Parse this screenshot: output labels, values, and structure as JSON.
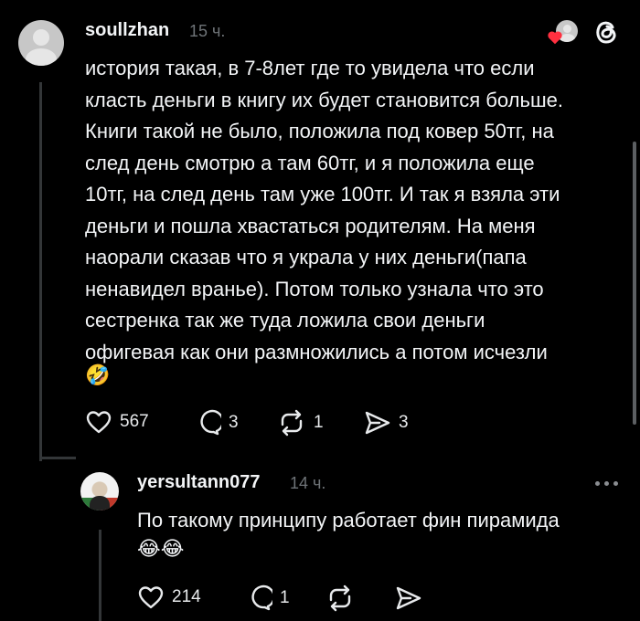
{
  "post": {
    "username": "soullzhan",
    "time": "15 ч.",
    "text": "история такая, в 7-8лет где то увидела что если\nкласть деньги в книгу их будет становится больше.\nКниги такой не было, положила под ковер 50тг, на\nслед день смотрю а там 60тг, и я положила еще\n10тг, на след день там уже 100тг. И так я взяла эти\nденьги и пошла хвастаться родителям. На меня\nнаорали сказав что я украла у них деньги(папа\nненавидел вранье). Потом только узнала что это\nсестренка так же туда ложила свои деньги\nофигевая как они размножились а потом исчезли",
    "emoji": "🤣",
    "likes": "567",
    "comments": "3",
    "reposts": "1",
    "shares": "3"
  },
  "reply": {
    "username": "yersultann077",
    "time": "14 ч.",
    "text": "По такому принципу работает фин пирамида",
    "emoji": "😂😂",
    "likes": "214",
    "comments": "1"
  },
  "icons": {
    "threads_logo": "threads-logo-icon",
    "like": "heart-icon",
    "comment": "comment-icon",
    "repost": "repost-icon",
    "share": "send-icon",
    "more": "more-icon"
  },
  "colors": {
    "background": "#000000",
    "text": "#f3f5f7",
    "secondary": "#6f7478",
    "heart_badge": "#ff3040"
  }
}
